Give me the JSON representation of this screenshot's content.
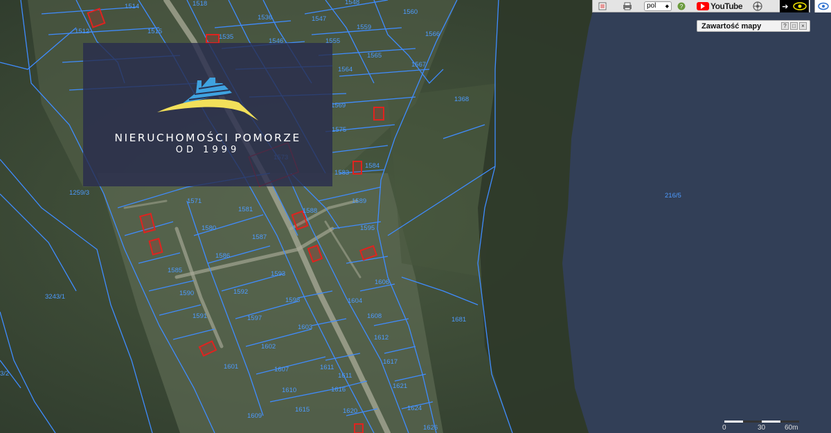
{
  "map": {
    "parcels": [
      "1514",
      "1518",
      "1536",
      "1547",
      "1548",
      "1560",
      "1559",
      "1566",
      "1512",
      "1515",
      "1535",
      "1546",
      "1555",
      "1565",
      "1567",
      "1564",
      "1368",
      "1569",
      "1575",
      "1583",
      "1584",
      "1589",
      "1595",
      "1611",
      "1571",
      "1581",
      "1580",
      "1587",
      "1588",
      "1586",
      "1593",
      "1585",
      "1592",
      "1598",
      "1590",
      "1597",
      "1603",
      "1591",
      "1602",
      "1601",
      "1607",
      "1610",
      "1615",
      "1620",
      "1609",
      "1616",
      "1611",
      "1612",
      "1608",
      "1617",
      "1604",
      "1621",
      "1624",
      "1626",
      "1606",
      "1259/3",
      "3243/1",
      "1681",
      "216/5",
      "1573",
      "3/2"
    ]
  },
  "logo": {
    "name": "NIERUCHOMOŚCI POMORZE",
    "since": "OD 1999",
    "colors": {
      "roof": "#3fa2e0",
      "swoosh": "#f2e05a"
    }
  },
  "toolbar": {
    "icons": [
      "legend-icon",
      "print-icon",
      "help-icon",
      "settings-icon"
    ],
    "language": "pol",
    "youtube_label": "YouTube"
  },
  "panel": {
    "title": "Zawartość mapy",
    "buttons": [
      "?",
      "□",
      "×"
    ]
  },
  "scale": {
    "labels": [
      "0",
      "30",
      "60m"
    ]
  },
  "colors": {
    "parcel_line": "#3f8cff",
    "building": "#e0231f",
    "water": "#323f57"
  }
}
